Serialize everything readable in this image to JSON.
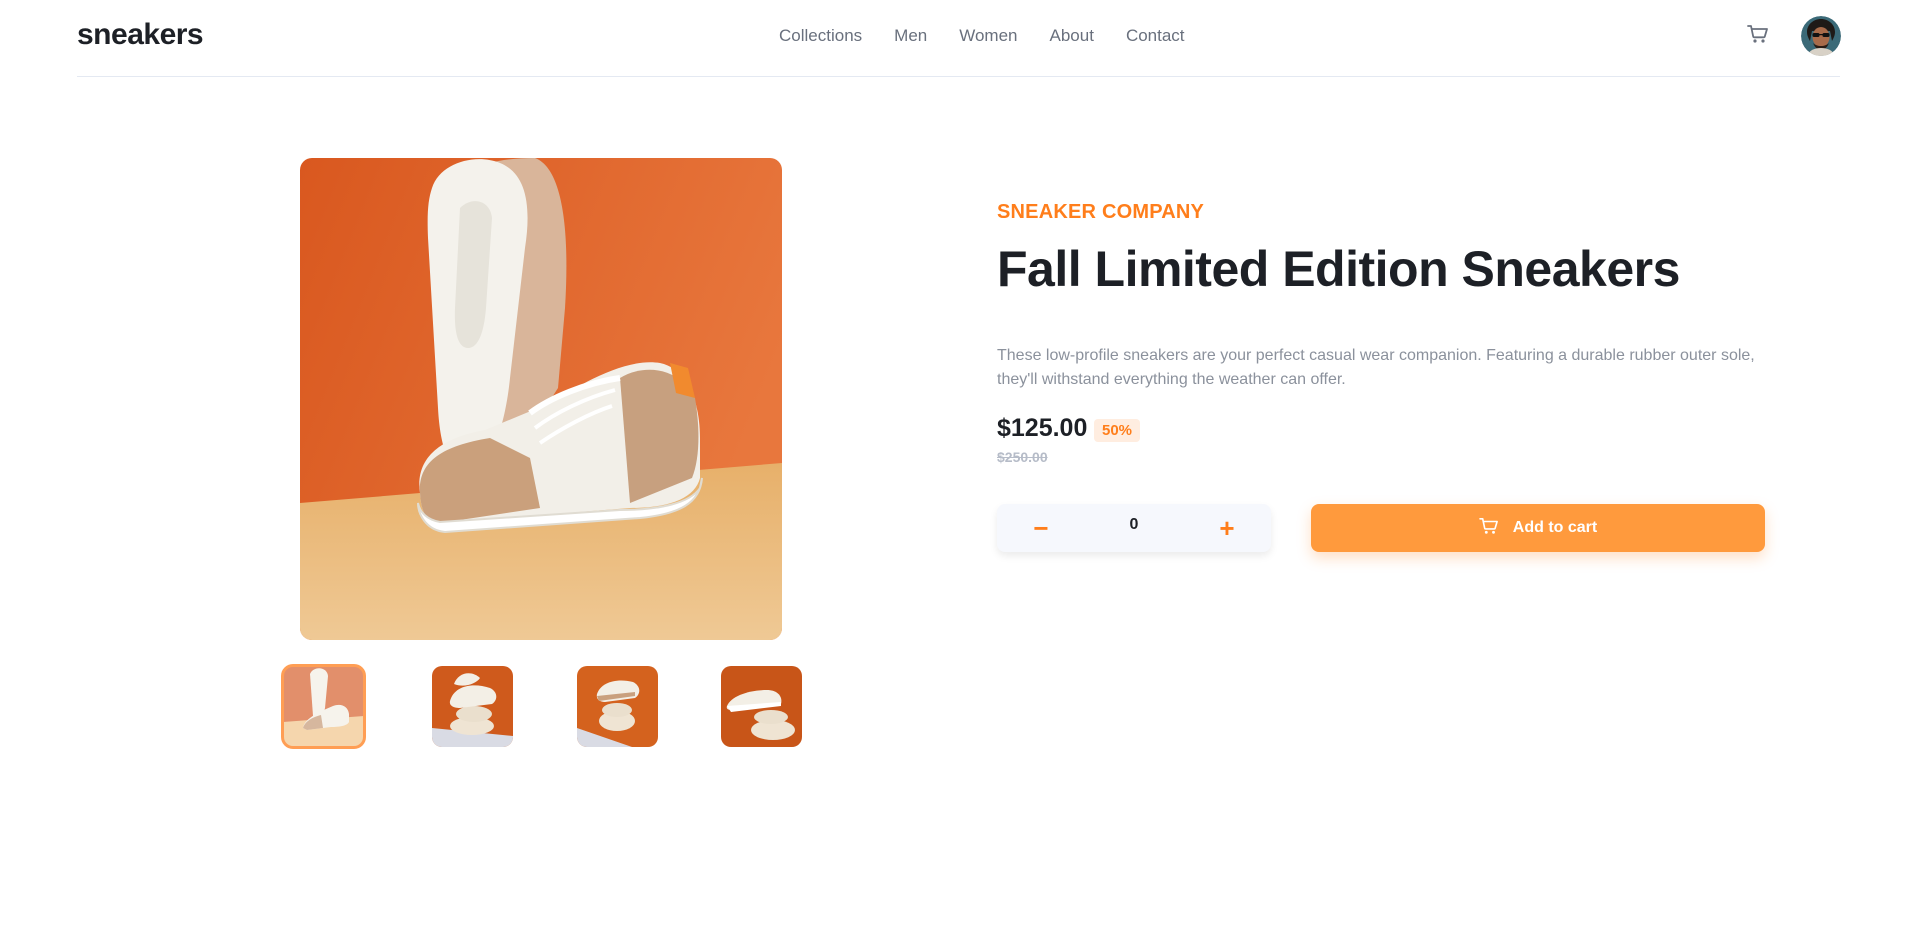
{
  "header": {
    "logo": "sneakers",
    "nav": [
      {
        "label": "Collections"
      },
      {
        "label": "Men"
      },
      {
        "label": "Women"
      },
      {
        "label": "About"
      },
      {
        "label": "Contact"
      }
    ],
    "cart_icon": "cart-icon",
    "avatar_icon": "avatar"
  },
  "gallery": {
    "selected_index": 0,
    "thumbnail_count": 4
  },
  "product": {
    "company": "SNEAKER COMPANY",
    "title": "Fall Limited Edition Sneakers",
    "description": "These low-profile sneakers are your perfect casual wear companion. Featuring a durable rubber outer sole, they'll withstand everything the weather can offer.",
    "price": "$125.00",
    "discount": "50%",
    "old_price": "$250.00",
    "quantity": "0",
    "minus_label": "−",
    "plus_label": "+",
    "add_to_cart_label": "Add to cart"
  },
  "colors": {
    "accent": "#ff7e1b",
    "accent_button": "#ff9a3d",
    "text_dark": "#1d2026",
    "text_muted": "#69707d",
    "discount_bg": "#ffede0"
  }
}
